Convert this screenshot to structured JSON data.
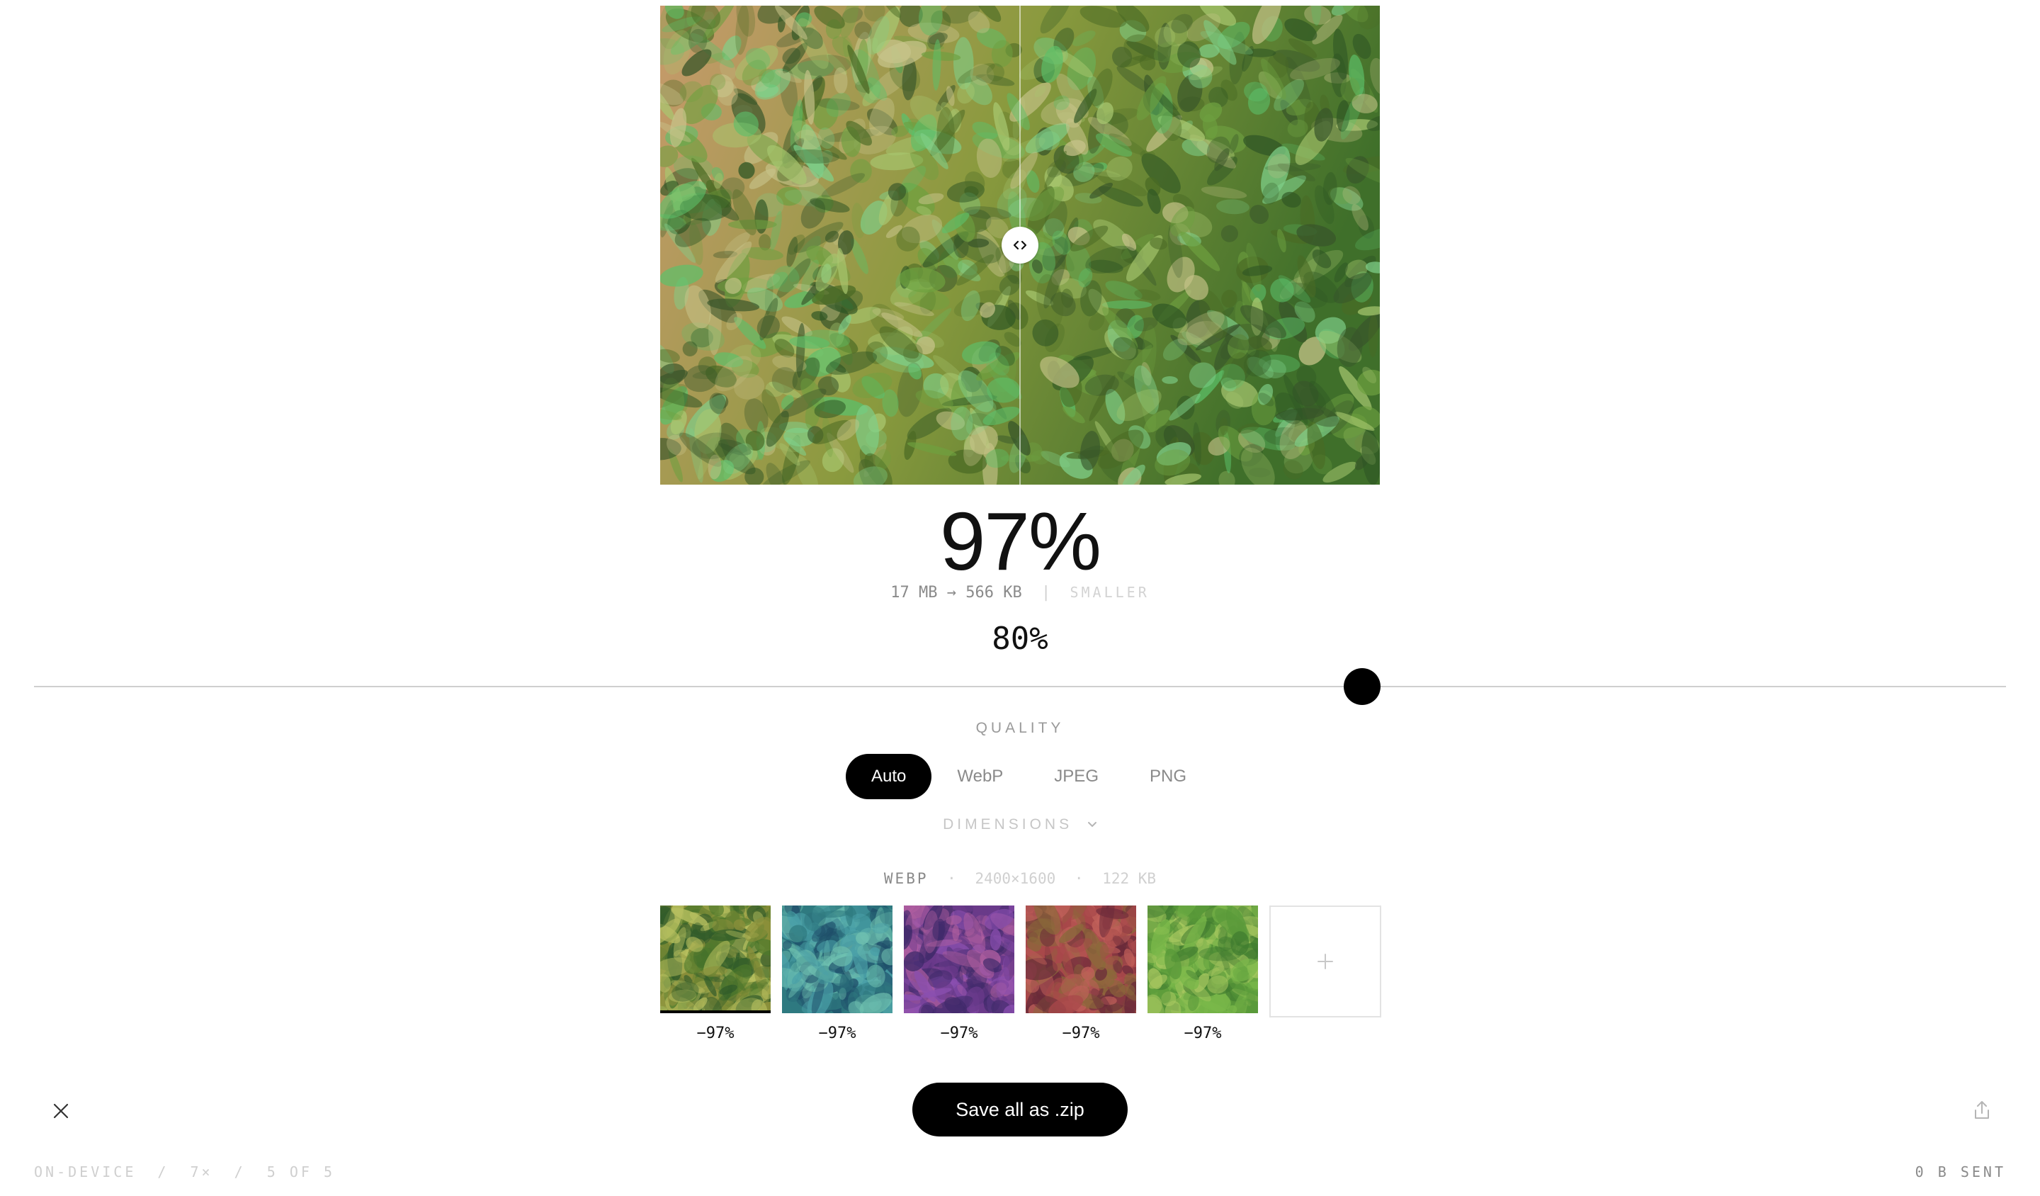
{
  "preview": {
    "comparison_handle_icon": "chevron-left-right-icon",
    "palettes": {
      "bg_left": "#c89a6c",
      "bg_mid": "#8a9a3e",
      "bg_right": "#3f6f2a",
      "leaves": [
        "#4a6a24",
        "#6ea040",
        "#5cc06a",
        "#a8c870",
        "#38552a",
        "#c7c48a",
        "#2e5524",
        "#7fd08a"
      ]
    }
  },
  "result": {
    "savings_percent": "97%",
    "original_size": "17 MB",
    "arrow": "→",
    "compressed_size": "566 KB",
    "separator": "|",
    "smaller_label": "SMALLER"
  },
  "quality": {
    "value_text": "80%",
    "value": 80,
    "label": "QUALITY"
  },
  "format_tabs": [
    {
      "label": "Auto",
      "active": true
    },
    {
      "label": "WebP",
      "active": false
    },
    {
      "label": "JPEG",
      "active": false
    },
    {
      "label": "PNG",
      "active": false
    }
  ],
  "dimensions": {
    "label": "DIMENSIONS",
    "icon": "chevron-down-icon"
  },
  "file_info": {
    "format": "WEBP",
    "dot": "·",
    "resolution": "2400×1600",
    "size": "122 KB"
  },
  "thumbnails": [
    {
      "saving": "−97%",
      "selected": true,
      "colors": [
        "#8a8f3a",
        "#4f7a2c",
        "#b8c060",
        "#2f5a2a"
      ]
    },
    {
      "saving": "−97%",
      "selected": false,
      "colors": [
        "#2f7a80",
        "#4aa0a8",
        "#6fc0b0",
        "#1f4f6a"
      ]
    },
    {
      "saving": "−97%",
      "selected": false,
      "colors": [
        "#6a3a8a",
        "#8a4fb0",
        "#b05fa0",
        "#3f2a6a"
      ]
    },
    {
      "saving": "−97%",
      "selected": false,
      "colors": [
        "#a8484a",
        "#c0605a",
        "#8a6a3a",
        "#6a2a3a"
      ]
    },
    {
      "saving": "−97%",
      "selected": false,
      "colors": [
        "#5a9a3a",
        "#7ab84a",
        "#3f7a2f",
        "#a8c860"
      ]
    }
  ],
  "add_tile": {
    "icon": "plus-icon"
  },
  "actions": {
    "save_all": "Save all as .zip",
    "close_icon": "close-icon",
    "share_icon": "share-icon"
  },
  "footer": {
    "mode": "ON-DEVICE",
    "slash": "/",
    "speed": "7×",
    "position": "5 OF 5",
    "sent": "0 B SENT"
  }
}
